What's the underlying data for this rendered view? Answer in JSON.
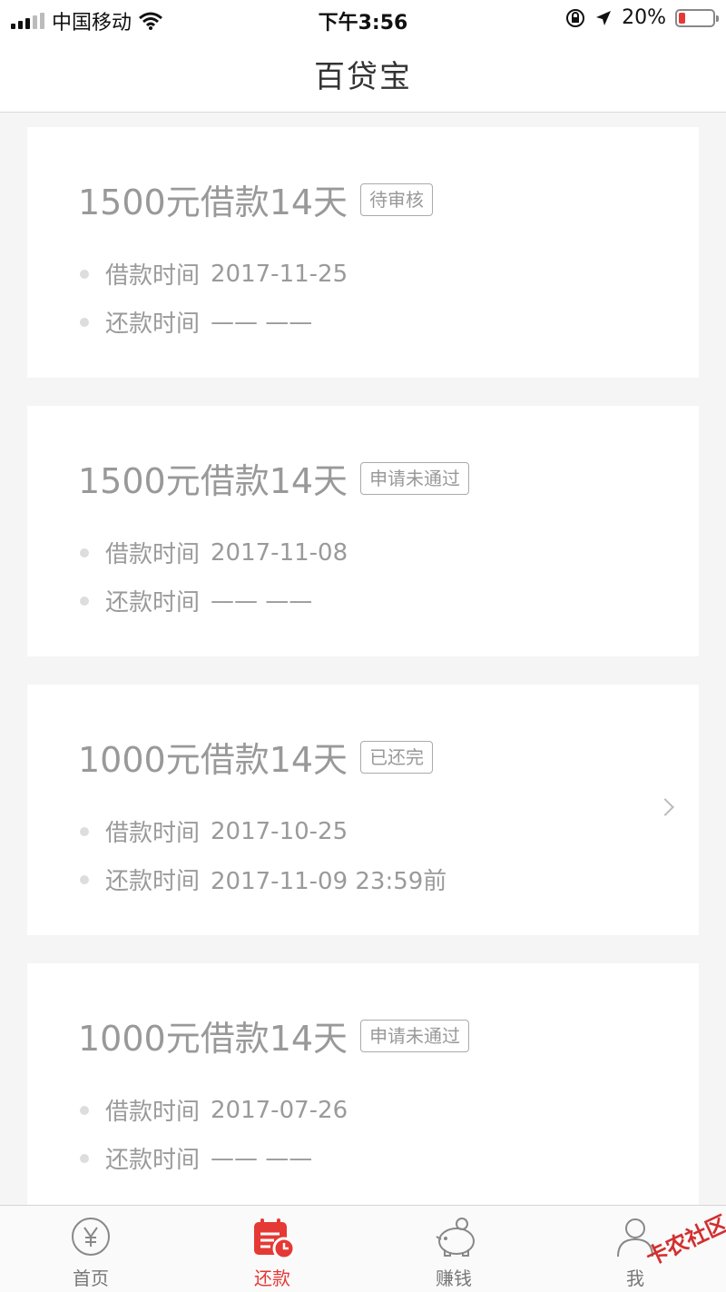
{
  "status_bar": {
    "carrier": "中国移动",
    "time": "下午3:56",
    "battery": "20%",
    "battery_level": 0.2
  },
  "nav": {
    "title": "百贷宝"
  },
  "loans": [
    {
      "title": "1500元借款14天",
      "status": "待审核",
      "borrow_label": "借款时间",
      "borrow_date": "2017-11-25",
      "repay_label": "还款时间",
      "repay_date": "—— ——",
      "has_arrow": false
    },
    {
      "title": "1500元借款14天",
      "status": "申请未通过",
      "borrow_label": "借款时间",
      "borrow_date": "2017-11-08",
      "repay_label": "还款时间",
      "repay_date": "—— ——",
      "has_arrow": false
    },
    {
      "title": "1000元借款14天",
      "status": "已还完",
      "borrow_label": "借款时间",
      "borrow_date": "2017-10-25",
      "repay_label": "还款时间",
      "repay_date": "2017-11-09 23:59前",
      "has_arrow": true
    },
    {
      "title": "1000元借款14天",
      "status": "申请未通过",
      "borrow_label": "借款时间",
      "borrow_date": "2017-07-26",
      "repay_label": "还款时间",
      "repay_date": "—— ——",
      "has_arrow": false
    }
  ],
  "tabs": [
    {
      "label": "首页",
      "icon": "yen-icon",
      "active": false
    },
    {
      "label": "还款",
      "icon": "calendar-clock-icon",
      "active": true
    },
    {
      "label": "赚钱",
      "icon": "piggy-bank-icon",
      "active": false
    },
    {
      "label": "我",
      "icon": "user-icon",
      "active": false
    }
  ],
  "watermark": "卡农社区",
  "colors": {
    "accent": "#e53935",
    "text_muted": "#999999",
    "background": "#f5f5f5"
  }
}
